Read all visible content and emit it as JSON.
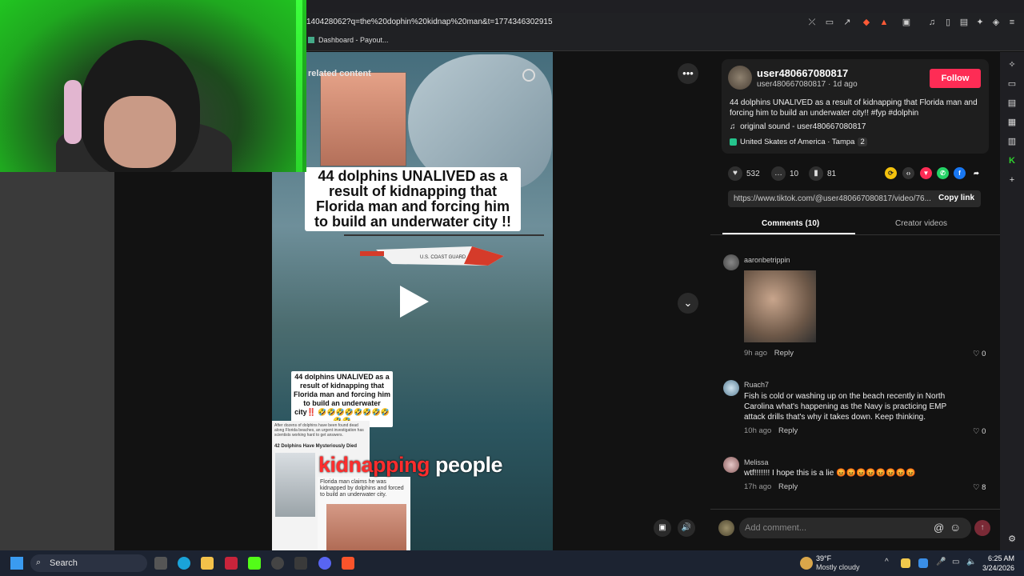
{
  "browser": {
    "url": "1404280621q=the%20dophin%20kidnap%20man&t=1774346302915",
    "url_display": "140428062?q=the%20dophin%20kidnap%20man&t=1774346302915",
    "bookmark": "Dashboard - Payout..."
  },
  "video": {
    "related_label": "related content",
    "caption": "44 dolphins UNALIVED as a result of kidnapping that Florida man and forcing him to build an underwater city !!",
    "small_caption": "44 dolphins UNALIVED as a result of kidnapping that Florida man and forcing him to build an underwater city‼️ 🤣🤣🤣🤣🤣🤣🤣🤣🤣🤣",
    "article_title": "42 Dolphins Have Mysteriously Died",
    "article_intro": "After dozens of dolphins have been found dead along Florida beaches, an urgent investigation has scientists working hard to get answers.",
    "article2_text": "Florida man claims he was kidnapped by dolphins and forced to build an underwater city.",
    "subtitle_highlight": "kidnapping",
    "subtitle_rest": "people",
    "heli_text": "U.S. COAST GUARD"
  },
  "post": {
    "username": "user480667080817",
    "subline": "user480667080817 · 1d ago",
    "follow_label": "Follow",
    "description": "44 dolphins UNALIVED as a result of kidnapping that Florida man and forcing him to build an underwater city!! #fyp #dolphin",
    "sound": "original sound - user480667080817",
    "location": "United Skates of America · Tampa",
    "location_count": "2",
    "likes": "532",
    "comments": "10",
    "saves": "81",
    "link": "https://www.tiktok.com/@user480667080817/video/76...",
    "copy_link": "Copy link"
  },
  "tabs": {
    "comments": "Comments (10)",
    "creator": "Creator videos"
  },
  "comments": [
    {
      "name": "aaronbetrippin",
      "text": "",
      "time": "9h ago",
      "reply": "Reply",
      "likes": "0"
    },
    {
      "name": "Ruach7",
      "text": "Fish is cold or washing up on the beach recently in North Carolina what's happening as the Navy is practicing EMP attack drills that's why it takes down. Keep thinking.",
      "time": "10h ago",
      "reply": "Reply",
      "likes": "0"
    },
    {
      "name": "Melissa",
      "text": "wtf!!!!!!! I hope this is a lie 😡😡😡😡😡😡😡😡",
      "time": "17h ago",
      "reply": "Reply",
      "likes": "8"
    }
  ],
  "comment_input": {
    "placeholder": "Add comment..."
  },
  "taskbar": {
    "search": "Search",
    "weather_temp": "39°F",
    "weather_desc": "Mostly cloudy",
    "time": "6:25 AM",
    "date": "3/24/2026"
  },
  "colors": {
    "accent": "#fe2c55",
    "bg": "#121212"
  }
}
